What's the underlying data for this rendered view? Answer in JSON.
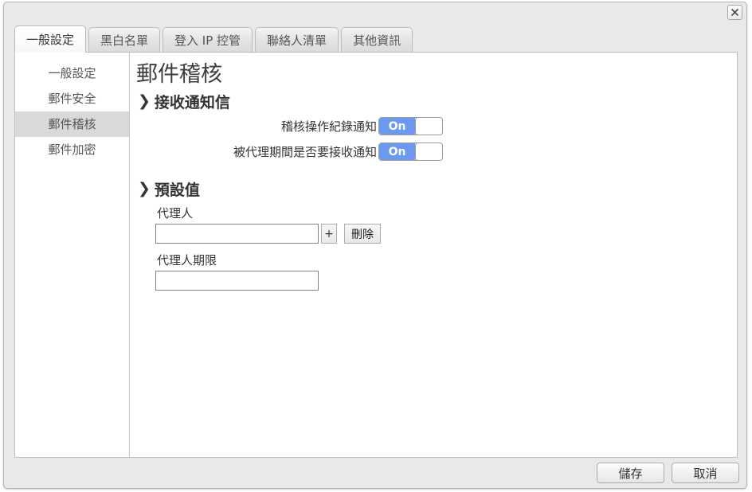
{
  "window": {
    "close_label": "✕"
  },
  "tabs": [
    {
      "label": "一般設定",
      "active": true
    },
    {
      "label": "黑白名單",
      "active": false
    },
    {
      "label": "登入 IP 控管",
      "active": false
    },
    {
      "label": "聯絡人清單",
      "active": false
    },
    {
      "label": "其他資訊",
      "active": false
    }
  ],
  "sidebar": {
    "items": [
      {
        "label": "一般設定",
        "selected": false
      },
      {
        "label": "郵件安全",
        "selected": false
      },
      {
        "label": "郵件稽核",
        "selected": true
      },
      {
        "label": "郵件加密",
        "selected": false
      }
    ]
  },
  "main": {
    "title": "郵件稽核",
    "sections": [
      {
        "chevron": "❯",
        "heading": "接收通知信",
        "toggles": [
          {
            "label": "稽核操作紀錄通知",
            "state": "On"
          },
          {
            "label": "被代理期間是否要接收通知",
            "state": "On"
          }
        ]
      },
      {
        "chevron": "❯",
        "heading": "預設值",
        "fields": [
          {
            "label": "代理人",
            "value": "",
            "placeholder": "",
            "add_label": "+",
            "delete_label": "刪除"
          },
          {
            "label": "代理人期限",
            "value": "",
            "placeholder": ""
          }
        ]
      }
    ]
  },
  "footer": {
    "save_label": "儲存",
    "cancel_label": "取消"
  },
  "colors": {
    "toggle_on": "#6a99ef",
    "selected_sidebar": "#d9d9d9",
    "window_bg": "#e9e9e9"
  }
}
